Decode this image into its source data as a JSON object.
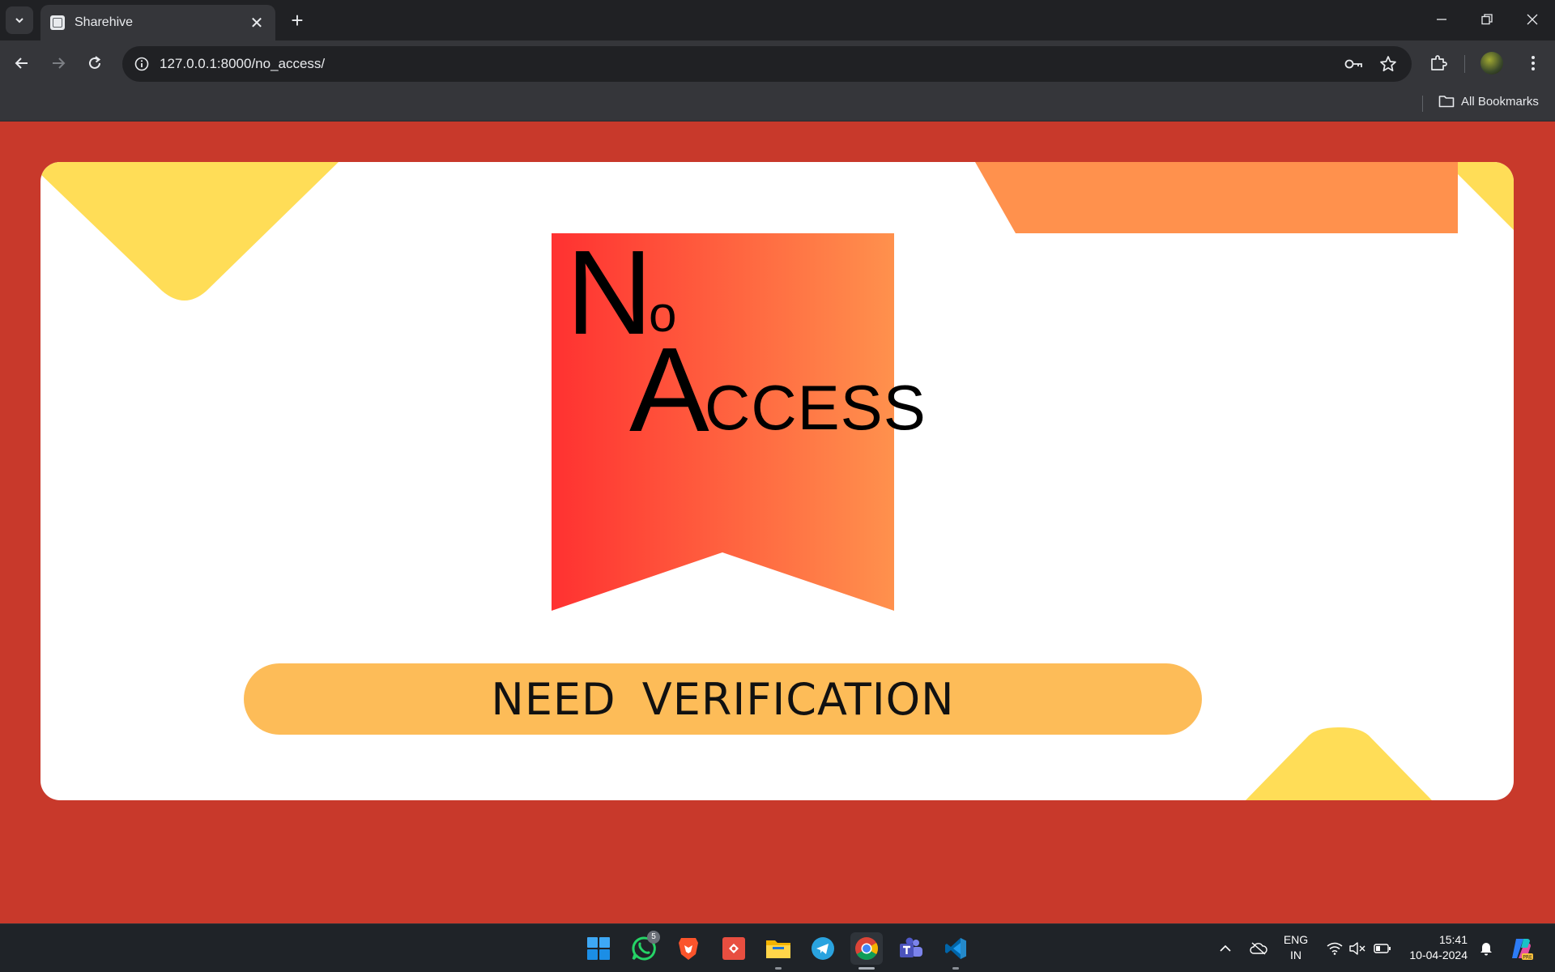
{
  "browser": {
    "tab_title": "Sharehive",
    "url": "127.0.0.1:8000/no_access/",
    "bookmarks_label": "All Bookmarks"
  },
  "page": {
    "logo_text_N": "N",
    "logo_text_o": "o",
    "logo_text_A": "A",
    "logo_text_ccess": "CCESS",
    "verify_label": "NEED VERIFICATION",
    "colors": {
      "background": "#c8392b",
      "card": "#ffffff",
      "yellow": "#ffdd57",
      "orange": "#ff914d",
      "ribbon_start": "#ff3131",
      "ribbon_end": "#ff914d",
      "button": "#fdbc58"
    }
  },
  "taskbar": {
    "whatsapp_badge": "5",
    "lang_line1": "ENG",
    "lang_line2": "IN",
    "time": "15:41",
    "date": "10-04-2024",
    "apps": [
      "windows-start-icon",
      "whatsapp-icon",
      "brave-icon",
      "git-icon",
      "file-explorer-icon",
      "telegram-icon",
      "chrome-icon",
      "teams-icon",
      "vscode-icon"
    ]
  }
}
